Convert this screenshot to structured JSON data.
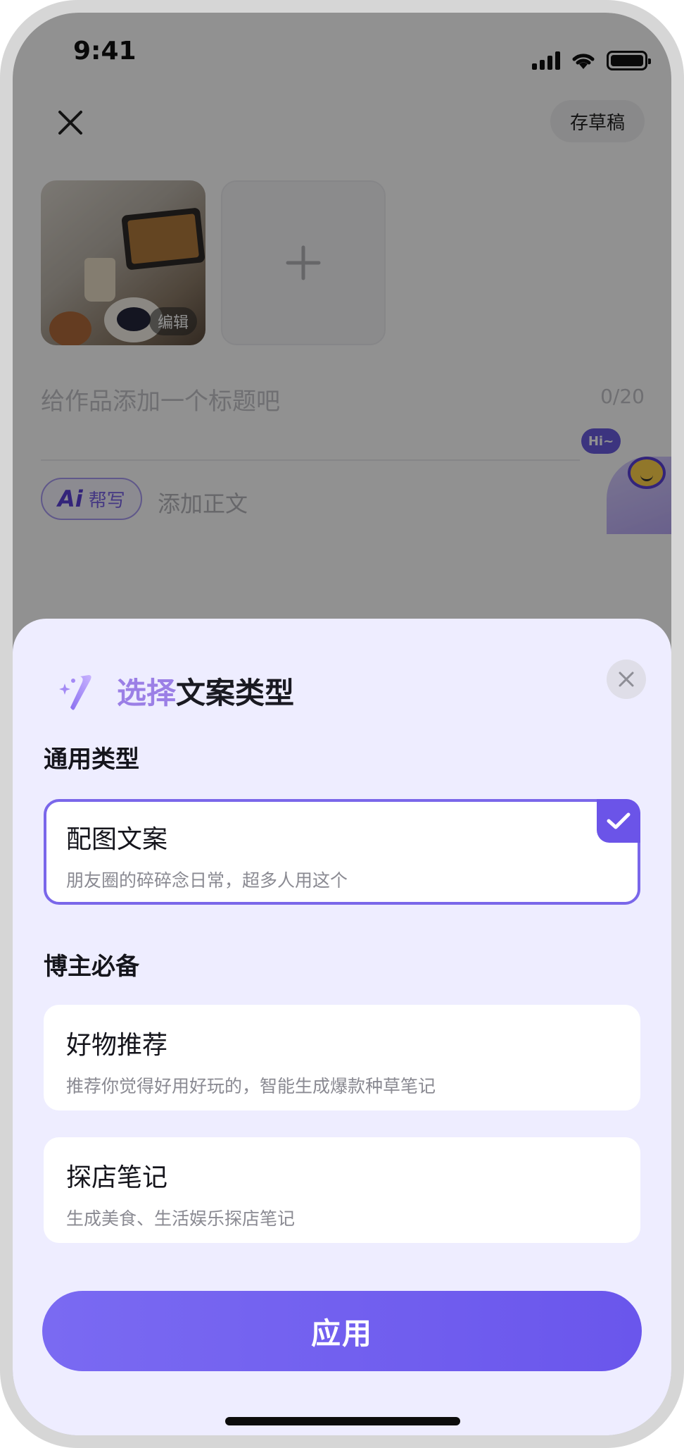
{
  "status_bar": {
    "time": "9:41"
  },
  "editor": {
    "draft_label": "存草稿",
    "edit_label": "编辑",
    "title_placeholder": "给作品添加一个标题吧",
    "title_counter": "0/20",
    "ai_label": "Ai",
    "ai_help_label": "帮写",
    "body_placeholder": "添加正文",
    "mascot_greeting": "Hi~"
  },
  "sheet": {
    "title_highlight": "选择",
    "title_rest": "文案类型",
    "sections": [
      {
        "label": "通用类型",
        "options": [
          {
            "title": "配图文案",
            "desc": "朋友圈的碎碎念日常，超多人用这个",
            "selected": true
          }
        ]
      },
      {
        "label": "博主必备",
        "options": [
          {
            "title": "好物推荐",
            "desc": "推荐你觉得好用好玩的，智能生成爆款种草笔记",
            "selected": false
          },
          {
            "title": "探店笔记",
            "desc": "生成美食、生活娱乐探店笔记",
            "selected": false
          }
        ]
      }
    ],
    "apply_label": "应用"
  },
  "colors": {
    "accent": "#6b54e8",
    "sheet_background": "#eeedff",
    "title_highlight": "#9b7fe6"
  },
  "icons": {
    "close": "close-icon",
    "plus": "plus-icon",
    "magic_wand": "magic-wand-icon",
    "check": "check-icon"
  }
}
